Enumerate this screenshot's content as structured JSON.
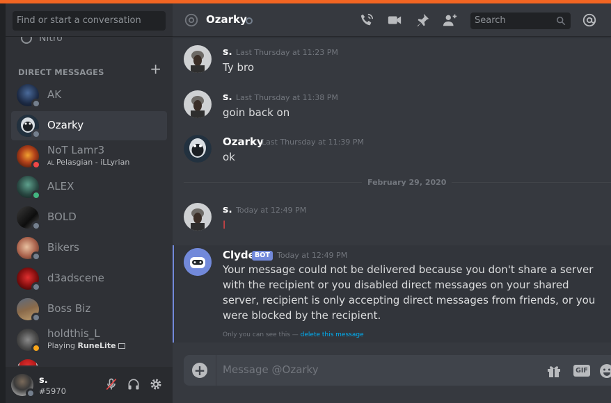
{
  "colors": {
    "accent": "#7289da",
    "online": "#43b581",
    "dnd": "#f04747",
    "idle": "#faa61a",
    "offline": "#747f8d",
    "link": "#00b0f4"
  },
  "sidebar": {
    "search_placeholder": "Find or start a conversation",
    "nitro_label": "Nitro",
    "dm_header": "DIRECT MESSAGES",
    "items": [
      {
        "name": "AK",
        "status": "offline"
      },
      {
        "name": "Ozarky",
        "status": "offline",
        "active": true
      },
      {
        "name": "NoT Lamr3",
        "status": "dnd",
        "sub_prefix": "AL",
        "sub": "Pelasgian - iLLyrian"
      },
      {
        "name": "ALEX",
        "status": "online"
      },
      {
        "name": "BOLD",
        "status": "offline"
      },
      {
        "name": "Bikers",
        "status": "offline"
      },
      {
        "name": "d3adscene",
        "status": "offline"
      },
      {
        "name": "Boss Biz",
        "status": "offline"
      },
      {
        "name": "holdthis_L",
        "status": "idle",
        "sub": "Playing ",
        "sub_bold": "RuneLite"
      }
    ]
  },
  "user": {
    "name": "s.",
    "tag": "#5970"
  },
  "header": {
    "title": "Ozarky",
    "search_placeholder": "Search"
  },
  "messages": [
    {
      "author": "s.",
      "time": "Last Thursday at 11:23 PM",
      "text": "Ty bro"
    },
    {
      "author": "s.",
      "time": "Last Thursday at 11:38 PM",
      "text": "goin back on"
    },
    {
      "author": "Ozarky",
      "time": "Last Thursday at 11:39 PM",
      "text": "ok"
    },
    {
      "author": "s.",
      "time": "Today at 12:49 PM",
      "text": "l"
    }
  ],
  "date_divider": "February 29, 2020",
  "clyde": {
    "author": "Clyde",
    "badge": "BOT",
    "time": "Today at 12:49 PM",
    "text": "Your message could not be delivered because you don't share a server with the recipient or you disabled direct messages on your shared server, recipient is only accepting direct messages from friends, or you were blocked by the recipient.",
    "note": "Only you can see this — ",
    "note_link": "delete this message"
  },
  "composer": {
    "placeholder": "Message @Ozarky",
    "gif_label": "GIF"
  }
}
